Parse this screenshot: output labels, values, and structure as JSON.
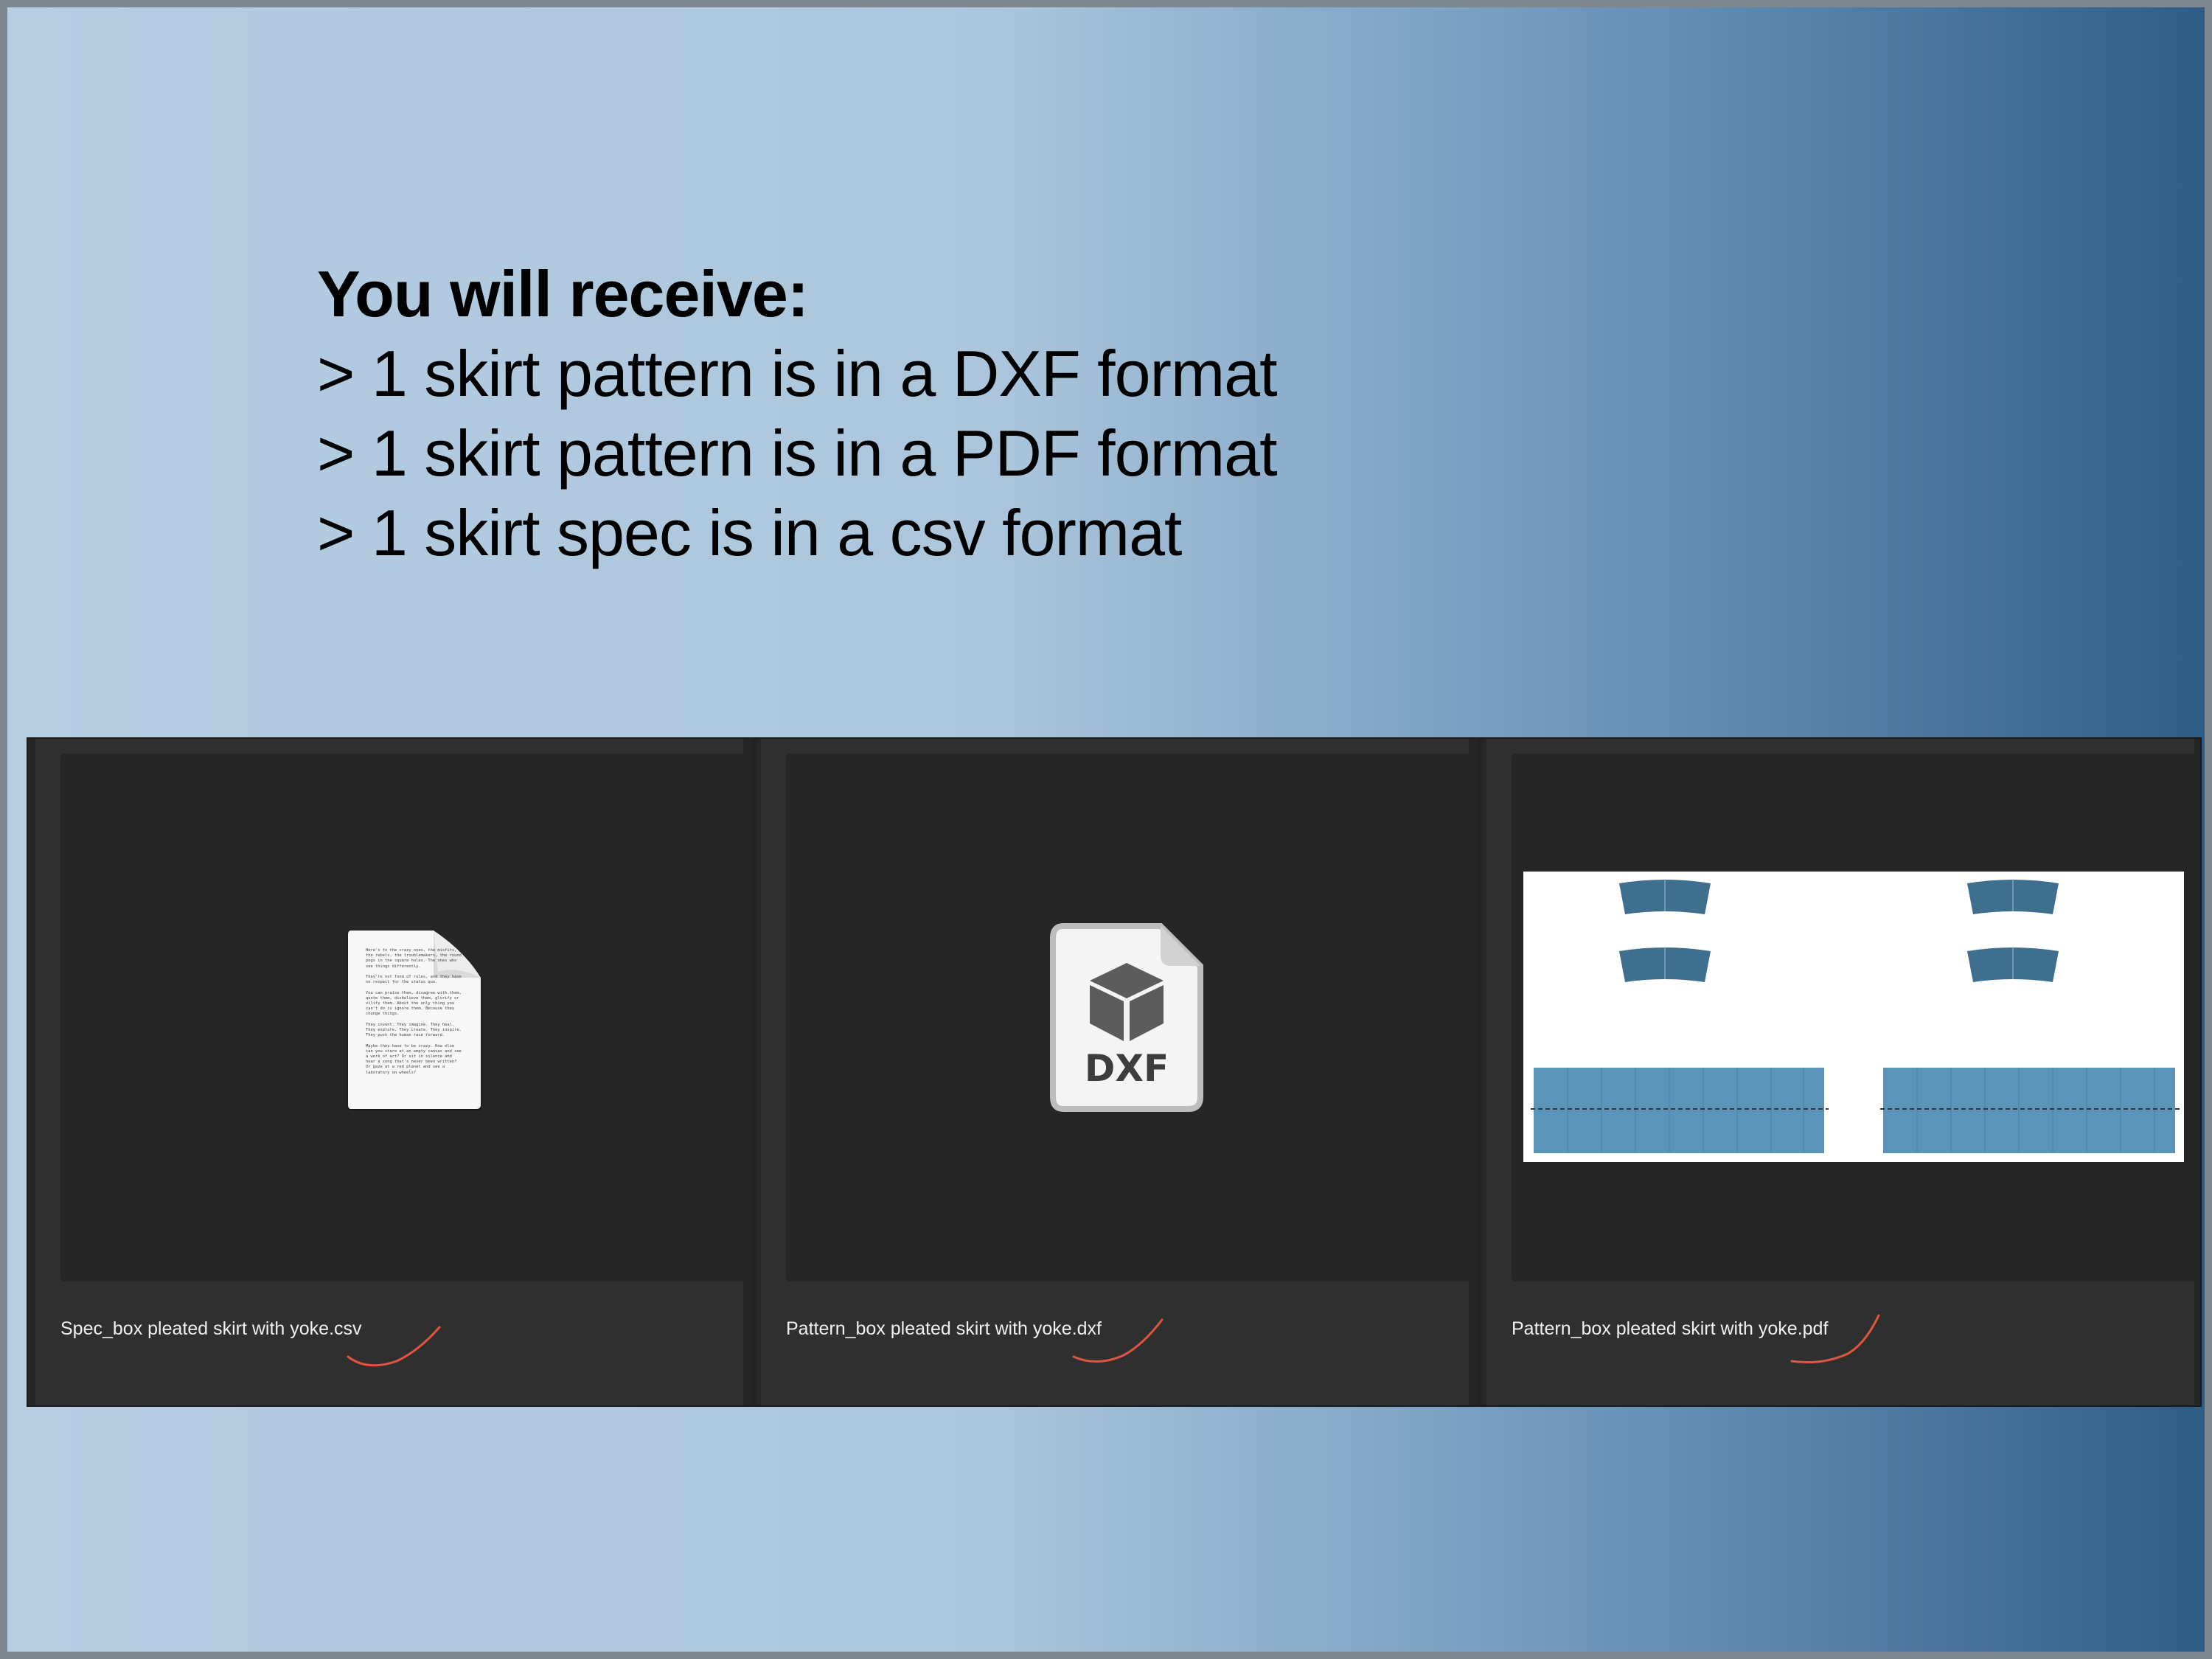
{
  "intro": {
    "title": "You will receive:",
    "lines": [
      "> 1 skirt pattern is in a DXF format",
      "> 1 skirt pattern is in a PDF format",
      "> 1 skirt spec is in a csv format"
    ]
  },
  "files": [
    {
      "name": "Spec_box pleated skirt with yoke.csv",
      "icon": "document-icon"
    },
    {
      "name": "Pattern_box pleated skirt with yoke.dxf",
      "icon": "dxf-file-icon",
      "icon_label": "DXF"
    },
    {
      "name": "Pattern_box pleated skirt with yoke.pdf",
      "icon": "pdf-pattern-thumbnail"
    }
  ],
  "doc_preview_text": "Here's to the crazy ones, the misfits, the rebels, the troublemakers, the round pegs in the square holes. The ones who see things differently.\n\nThey're not fond of rules, and they have no respect for the status quo.\n\nYou can praise them, disagree with them, quote them, disbelieve them, glorify or vilify them. About the only thing you can't do is ignore them. Because they change things.\n\nThey invent. They imagine. They heal. They explore. They create. They inspire. They push the human race forward.\n\nMaybe they have to be crazy. How else can you stare at an empty canvas and see a work of art? Or sit in silence and hear a song that's never been written? Or gaze at a red planet and see a laboratory on wheels?",
  "colors": {
    "gradient_light": "#b6cde2",
    "gradient_dark": "#2f5c86",
    "scribble": "#e0553d",
    "pattern_piece": "#3f6f8e",
    "pattern_panel": "#5b94b8"
  }
}
